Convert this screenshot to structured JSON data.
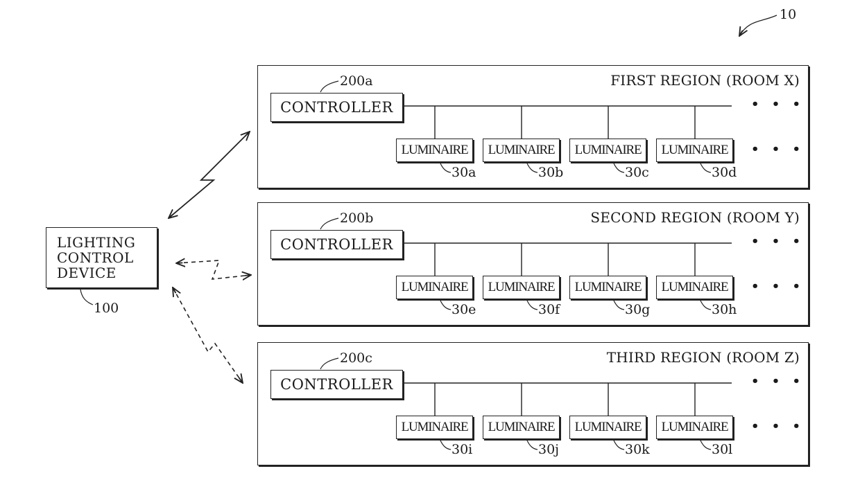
{
  "figure": {
    "reference": "10"
  },
  "lighting_control_device": {
    "lines": [
      "LIGHTING",
      "CONTROL",
      "DEVICE"
    ],
    "reference": "100"
  },
  "links": [
    {
      "target_region": 0,
      "style": "solid",
      "bidirectional": true
    },
    {
      "target_region": 1,
      "style": "dashed",
      "bidirectional": true
    },
    {
      "target_region": 2,
      "style": "dashed",
      "bidirectional": true
    }
  ],
  "regions": [
    {
      "title": "FIRST REGION (ROOM X)",
      "controller": {
        "label": "CONTROLLER",
        "reference": "200a"
      },
      "luminaires": [
        {
          "label": "LUMINAIRE",
          "reference": "30a"
        },
        {
          "label": "LUMINAIRE",
          "reference": "30b"
        },
        {
          "label": "LUMINAIRE",
          "reference": "30c"
        },
        {
          "label": "LUMINAIRE",
          "reference": "30d"
        }
      ],
      "ellipsis": "• • •"
    },
    {
      "title": "SECOND REGION (ROOM Y)",
      "controller": {
        "label": "CONTROLLER",
        "reference": "200b"
      },
      "luminaires": [
        {
          "label": "LUMINAIRE",
          "reference": "30e"
        },
        {
          "label": "LUMINAIRE",
          "reference": "30f"
        },
        {
          "label": "LUMINAIRE",
          "reference": "30g"
        },
        {
          "label": "LUMINAIRE",
          "reference": "30h"
        }
      ],
      "ellipsis": "• • •"
    },
    {
      "title": "THIRD REGION (ROOM Z)",
      "controller": {
        "label": "CONTROLLER",
        "reference": "200c"
      },
      "luminaires": [
        {
          "label": "LUMINAIRE",
          "reference": "30i"
        },
        {
          "label": "LUMINAIRE",
          "reference": "30j"
        },
        {
          "label": "LUMINAIRE",
          "reference": "30k"
        },
        {
          "label": "LUMINAIRE",
          "reference": "30l"
        }
      ],
      "ellipsis": "• • •"
    }
  ]
}
